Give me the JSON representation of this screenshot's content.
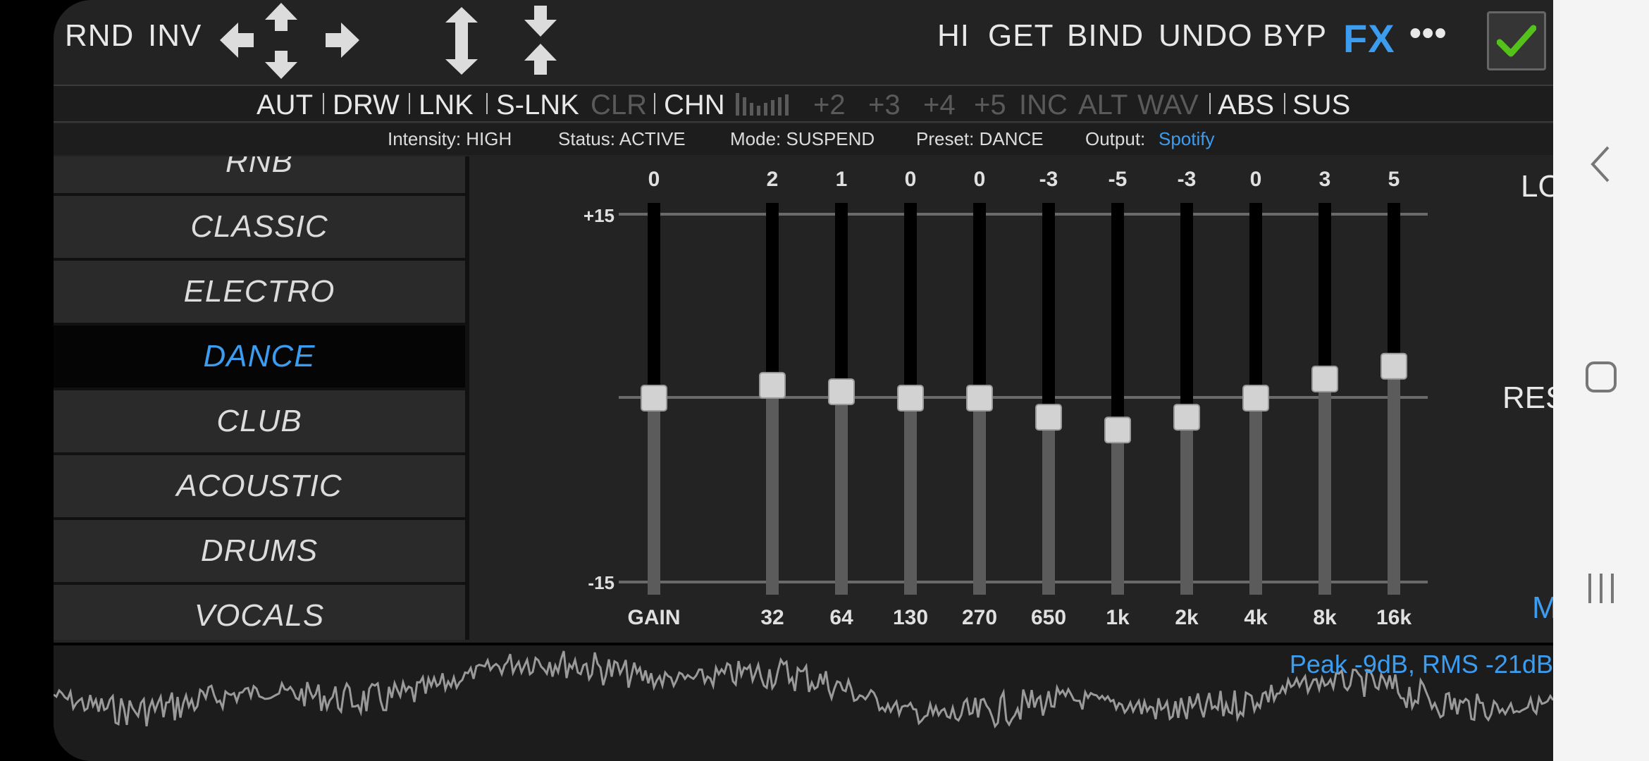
{
  "toolbar": {
    "left_buttons": [
      "RND",
      "INV"
    ],
    "right_buttons": [
      "HI",
      "GET",
      "BIND",
      "UNDO",
      "BYP"
    ],
    "fx_label": "FX",
    "more_label": "•••"
  },
  "mode_row": {
    "items": [
      {
        "label": "AUT",
        "active": true
      },
      {
        "label": "DRW",
        "active": true
      },
      {
        "label": "LNK",
        "active": true
      },
      {
        "label": "S-LNK",
        "active": true
      },
      {
        "label": "CLR",
        "active": false
      },
      {
        "label": "CHN",
        "active": true
      },
      {
        "label": "+2",
        "active": false
      },
      {
        "label": "+3",
        "active": false
      },
      {
        "label": "+4",
        "active": false
      },
      {
        "label": "+5",
        "active": false
      },
      {
        "label": "INC",
        "active": false
      },
      {
        "label": "ALT",
        "active": false
      },
      {
        "label": "WAV",
        "active": false
      },
      {
        "label": "ABS",
        "active": true
      },
      {
        "label": "SUS",
        "active": true
      }
    ]
  },
  "info_row": {
    "intensity": "Intensity: HIGH",
    "status": "Status: ACTIVE",
    "mode": "Mode: SUSPEND",
    "preset": "Preset: DANCE",
    "output_label": "Output:",
    "output_value": "Spotify"
  },
  "presets": {
    "items": [
      "RNB",
      "CLASSIC",
      "ELECTRO",
      "DANCE",
      "CLUB",
      "ACOUSTIC",
      "DRUMS",
      "VOCALS"
    ],
    "selected": "DANCE"
  },
  "eq": {
    "scale_top_label": "+15",
    "scale_bottom_label": "-15",
    "scale_max": 15,
    "scale_min": -15,
    "bands": [
      {
        "label": "GAIN",
        "value": 0
      },
      {
        "label": "32",
        "value": 2
      },
      {
        "label": "64",
        "value": 1
      },
      {
        "label": "130",
        "value": 0
      },
      {
        "label": "270",
        "value": 0
      },
      {
        "label": "650",
        "value": -3
      },
      {
        "label": "1k",
        "value": -5
      },
      {
        "label": "2k",
        "value": -3
      },
      {
        "label": "4k",
        "value": 0
      },
      {
        "label": "8k",
        "value": 3
      },
      {
        "label": "16k",
        "value": 5
      }
    ]
  },
  "side_buttons": {
    "lock": "LOCK",
    "reset": "RESET",
    "mtr": "MTR"
  },
  "meter": {
    "text": "Peak -9dB, RMS -21dB"
  },
  "colors": {
    "accent": "#3c9cf0",
    "check": "#55c21b",
    "background": "#232323"
  }
}
